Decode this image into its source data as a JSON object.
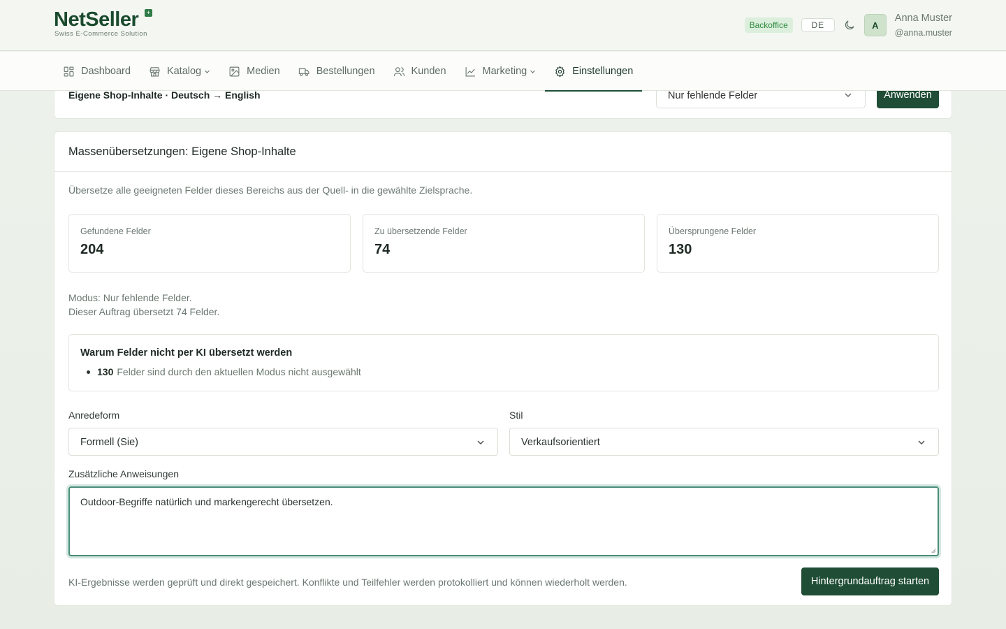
{
  "header": {
    "brand": {
      "name_part1": "Net",
      "name_part2": "Seller",
      "badge": "+",
      "tagline": "Swiss E-Commerce Solution"
    },
    "backoffice_badge": "Backoffice",
    "language": "DE",
    "theme_icon": "moon-icon",
    "user": {
      "initial": "A",
      "name": "Anna Muster",
      "handle": "@anna.muster"
    }
  },
  "nav": {
    "items": [
      {
        "label": "Dashboard",
        "icon": "dashboard-icon"
      },
      {
        "label": "Katalog",
        "icon": "store-icon",
        "has_dropdown": true
      },
      {
        "label": "Medien",
        "icon": "image-icon"
      },
      {
        "label": "Bestellungen",
        "icon": "truck-icon"
      },
      {
        "label": "Kunden",
        "icon": "users-icon"
      },
      {
        "label": "Marketing",
        "icon": "chart-icon",
        "has_dropdown": true
      },
      {
        "label": "Einstellungen",
        "icon": "gear-icon",
        "active": true
      }
    ]
  },
  "top_card": {
    "breadcrumb": "Eigene Shop-Inhalte · Deutsch → English",
    "mode_select_value": "Nur fehlende Felder",
    "apply_label": "Anwenden"
  },
  "main_card": {
    "title": "Massenübersetzungen: Eigene Shop-Inhalte",
    "intro": "Übersetze alle geeigneten Felder dieses Bereichs aus der Quell- in die gewählte Zielsprache.",
    "stats": [
      {
        "label": "Gefundene Felder",
        "value": "204"
      },
      {
        "label": "Zu übersetzende Felder",
        "value": "74"
      },
      {
        "label": "Übersprungene Felder",
        "value": "130"
      }
    ],
    "mode_line1": "Modus: Nur fehlende Felder.",
    "mode_line2": "Dieser Auftrag übersetzt 74 Felder.",
    "why": {
      "title": "Warum Felder nicht per KI übersetzt werden",
      "items": [
        {
          "count": "130",
          "text": "Felder sind durch den aktuellen Modus nicht ausgewählt"
        }
      ]
    },
    "form": {
      "anrede_label": "Anredeform",
      "anrede_value": "Formell (Sie)",
      "stil_label": "Stil",
      "stil_value": "Verkaufsorientiert",
      "instructions_label": "Zusätzliche Anweisungen",
      "instructions_value": "Outdoor-Begriffe natürlich und markengerecht übersetzen."
    },
    "footer_note": "KI-Ergebnisse werden geprüft und direkt gespeichert. Konflikte und Teilfehler werden protokolliert und können wiederholt werden.",
    "start_label": "Hintergrundauftrag starten"
  },
  "colors": {
    "primary": "#1f4d35",
    "accent_focus": "#4a8d7a",
    "badge_bg": "#dcefdc",
    "badge_text": "#2f8a3f"
  }
}
